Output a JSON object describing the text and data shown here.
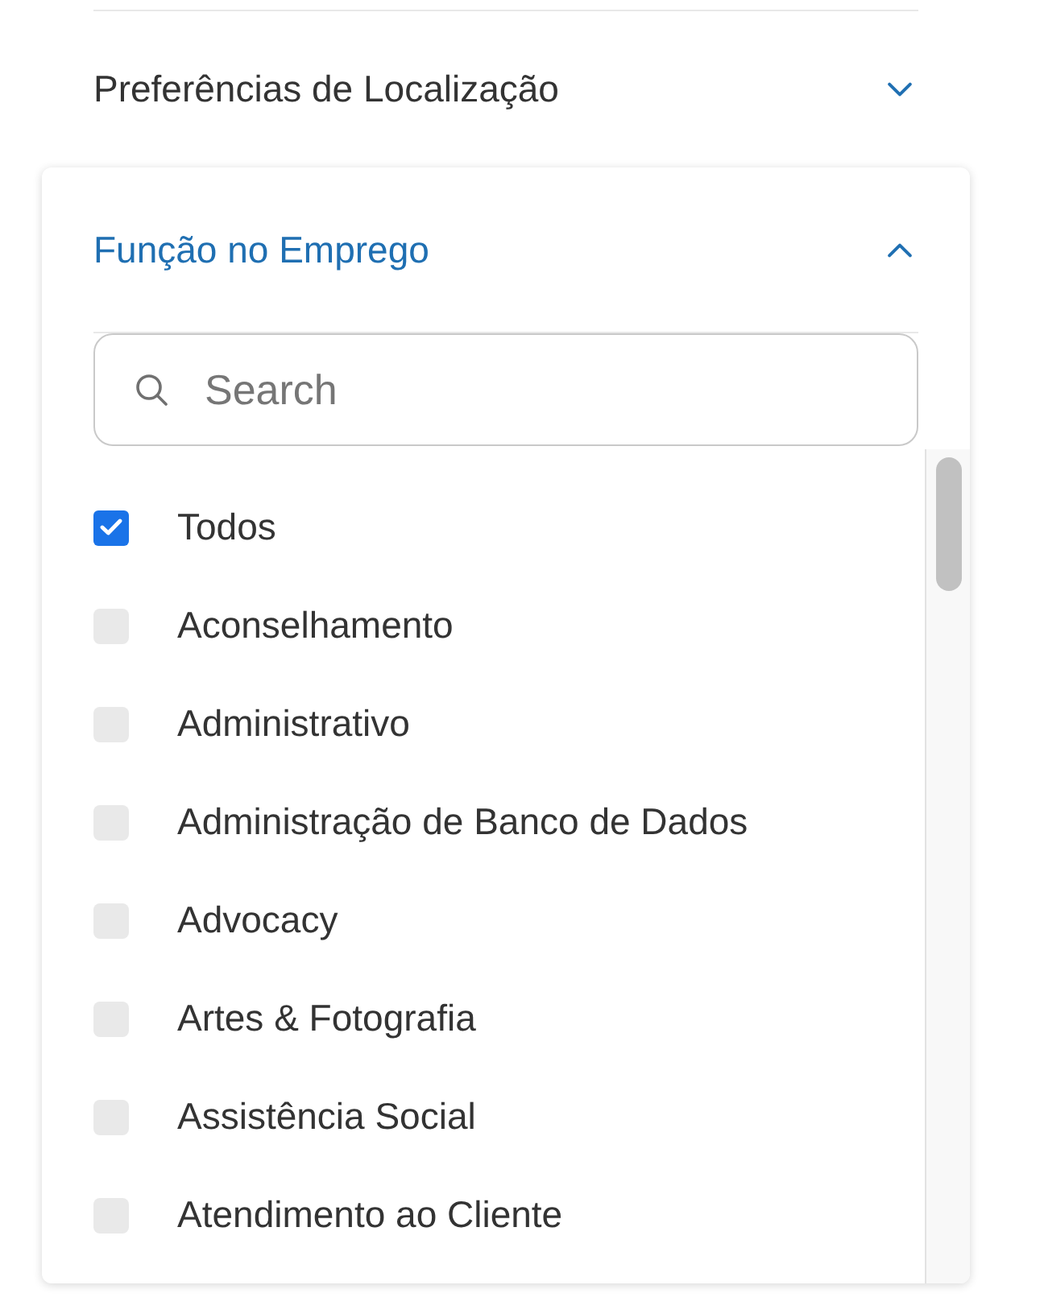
{
  "sections": [
    {
      "title": "Preferências de Localização",
      "expanded": false
    },
    {
      "title": "Função no Emprego",
      "expanded": true,
      "search": {
        "placeholder": "Search"
      },
      "options": [
        {
          "label": "Todos",
          "checked": true
        },
        {
          "label": "Aconselhamento",
          "checked": false
        },
        {
          "label": "Administrativo",
          "checked": false
        },
        {
          "label": "Administração de Banco de Dados",
          "checked": false
        },
        {
          "label": "Advocacy",
          "checked": false
        },
        {
          "label": "Artes & Fotografia",
          "checked": false
        },
        {
          "label": "Assistência Social",
          "checked": false
        },
        {
          "label": "Atendimento ao Cliente",
          "checked": false
        }
      ]
    }
  ]
}
